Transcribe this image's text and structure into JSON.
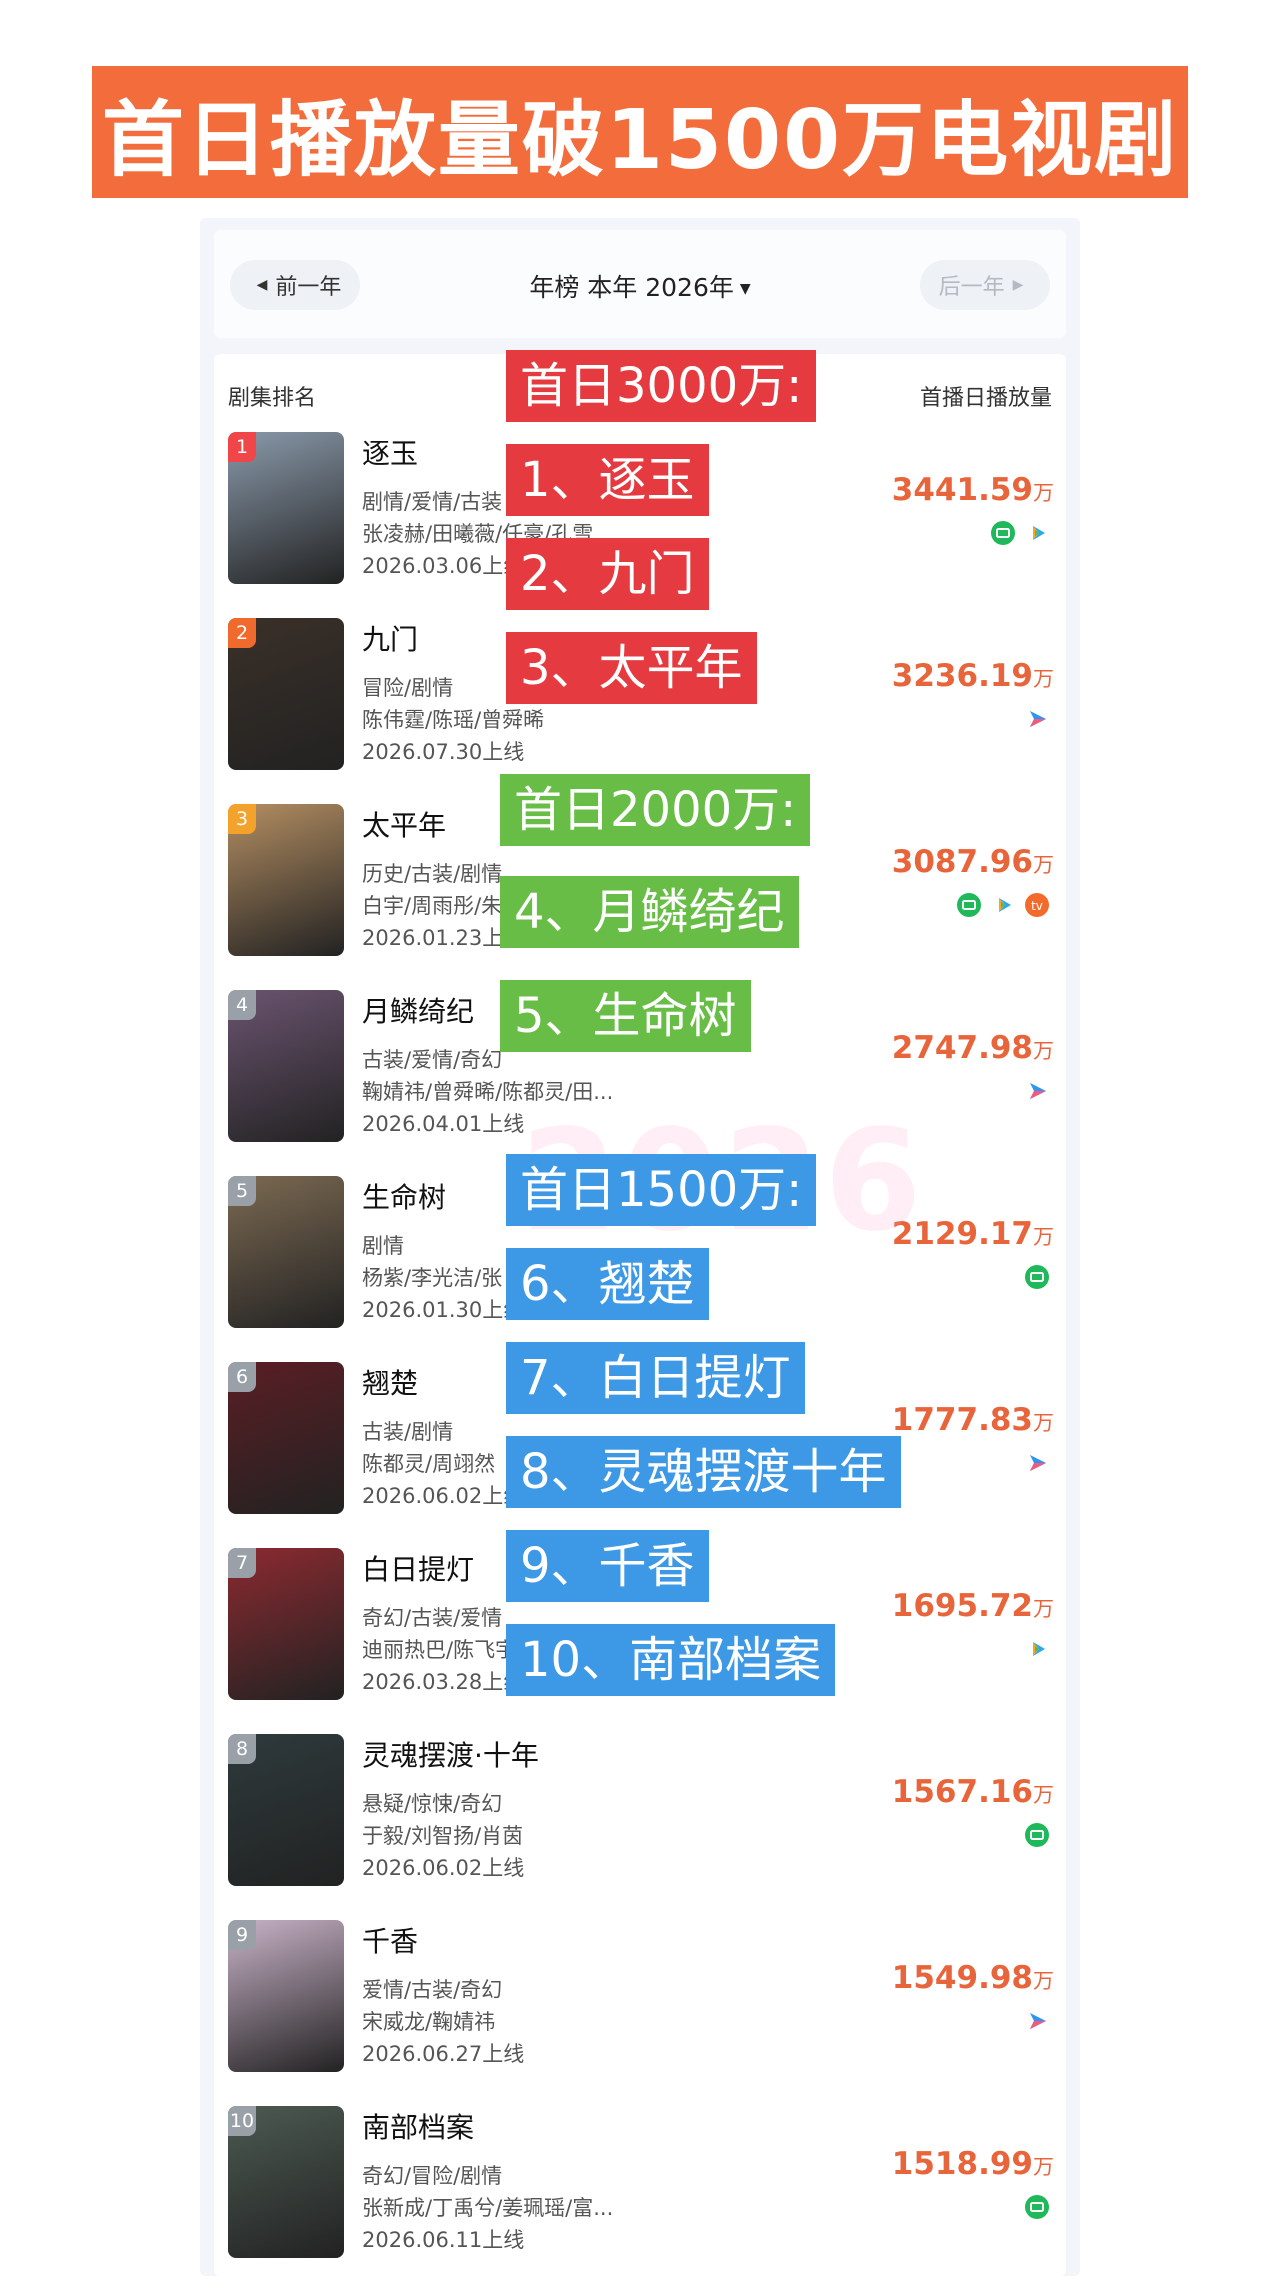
{
  "banner": {
    "title": "首日播放量破1500万电视剧"
  },
  "nav": {
    "prev": "前一年",
    "title": "年榜 本年 2026年",
    "next": "后一年"
  },
  "list_header": {
    "left": "剧集排名",
    "right": "首播日播放量"
  },
  "unit": "万",
  "watermark": "2026",
  "rows": [
    {
      "rank": "1",
      "name": "逐玉",
      "genre": "剧情/爱情/古装",
      "cast": "张凌赫/田曦薇/任豪/孔雪",
      "date": "2026.03.06上线",
      "plays": "3441.59",
      "platforms": [
        "iqiyi-icon",
        "tencent-play-icon"
      ],
      "rank_color": "#f0464a",
      "poster_color": "#8a9aab"
    },
    {
      "rank": "2",
      "name": "九门",
      "genre": "冒险/剧情",
      "cast": "陈伟霆/陈瑶/曾舜晞",
      "date": "2026.07.30上线",
      "plays": "3236.19",
      "platforms": [
        "youku-icon"
      ],
      "rank_color": "#f06a2d",
      "poster_color": "#3a3028"
    },
    {
      "rank": "3",
      "name": "太平年",
      "genre": "历史/古装/剧情",
      "cast": "白宇/周雨彤/朱",
      "date": "2026.01.23上线",
      "plays": "3087.96",
      "platforms": [
        "iqiyi-icon",
        "tencent-play-icon",
        "mango-icon"
      ],
      "rank_color": "#f3a32b",
      "poster_color": "#b48e62"
    },
    {
      "rank": "4",
      "name": "月鳞绮纪",
      "genre": "古装/爱情/奇幻",
      "cast": "鞠婧祎/曾舜晞/陈都灵/田...",
      "date": "2026.04.01上线",
      "plays": "2747.98",
      "platforms": [
        "youku-icon"
      ],
      "rank_color": "#9aa0a8",
      "poster_color": "#6b5470"
    },
    {
      "rank": "5",
      "name": "生命树",
      "genre": "剧情",
      "cast": "杨紫/李光洁/张",
      "date": "2026.01.30上线",
      "plays": "2129.17",
      "platforms": [
        "iqiyi-icon"
      ],
      "rank_color": "#9aa0a8",
      "poster_color": "#7c6a52"
    },
    {
      "rank": "6",
      "name": "翘楚",
      "genre": "古装/剧情",
      "cast": "陈都灵/周翊然",
      "date": "2026.06.02上线",
      "plays": "1777.83",
      "platforms": [
        "youku-icon"
      ],
      "rank_color": "#9aa0a8",
      "poster_color": "#5a1e24"
    },
    {
      "rank": "7",
      "name": "白日提灯",
      "genre": "奇幻/古装/爱情",
      "cast": "迪丽热巴/陈飞宇",
      "date": "2026.03.28上线",
      "plays": "1695.72",
      "platforms": [
        "tencent-play-icon"
      ],
      "rank_color": "#9aa0a8",
      "poster_color": "#8c2a30"
    },
    {
      "rank": "8",
      "name": "灵魂摆渡·十年",
      "genre": "悬疑/惊悚/奇幻",
      "cast": "于毅/刘智扬/肖茵",
      "date": "2026.06.02上线",
      "plays": "1567.16",
      "platforms": [
        "iqiyi-icon"
      ],
      "rank_color": "#9aa0a8",
      "poster_color": "#2e3a3c"
    },
    {
      "rank": "9",
      "name": "千香",
      "genre": "爱情/古装/奇幻",
      "cast": "宋威龙/鞠婧祎",
      "date": "2026.06.27上线",
      "plays": "1549.98",
      "platforms": [
        "youku-icon"
      ],
      "rank_color": "#9aa0a8",
      "poster_color": "#c9b3c8"
    },
    {
      "rank": "10",
      "name": "南部档案",
      "genre": "奇幻/冒险/剧情",
      "cast": "张新成/丁禹兮/姜珮瑶/富...",
      "date": "2026.06.11上线",
      "plays": "1518.99",
      "platforms": [
        "iqiyi-icon"
      ],
      "rank_color": "#9aa0a8",
      "poster_color": "#4c5a52"
    }
  ],
  "overlay": {
    "red_header": "首日3000万:",
    "red_items": [
      "1、逐玉",
      "2、九门",
      "3、太平年"
    ],
    "green_header": "首日2000万:",
    "green_items": [
      "4、月鳞绮纪",
      "5、生命树"
    ],
    "blue_header": "首日1500万:",
    "blue_items": [
      "6、翘楚",
      "7、白日提灯",
      "8、灵魂摆渡十年",
      "9、千香",
      "10、南部档案"
    ]
  },
  "colors": {
    "banner": "#f36c3c",
    "plays": "#e8643a",
    "red": "#e53b40",
    "green": "#67bd46",
    "blue": "#3d98e6"
  }
}
